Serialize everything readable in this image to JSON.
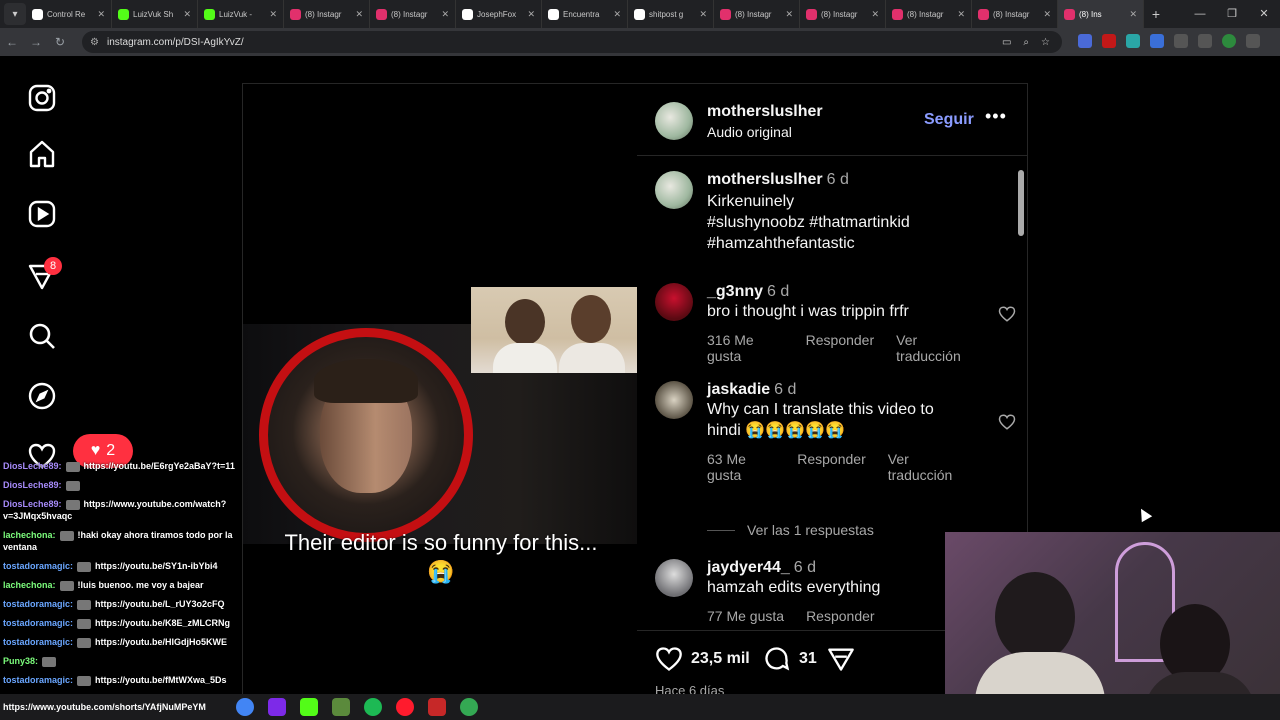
{
  "browser": {
    "tabs": [
      {
        "label": "Control Re",
        "color": "#ffffff"
      },
      {
        "label": "LuizVuk Sh",
        "color": "#53fc18"
      },
      {
        "label": "LuizVuk - ",
        "color": "#53fc18"
      },
      {
        "label": "(8) Instagr",
        "color": "#e1306c"
      },
      {
        "label": "(8) Instagr",
        "color": "#e1306c"
      },
      {
        "label": "JosephFox",
        "color": "#ffffff"
      },
      {
        "label": "Encuentra",
        "color": "#ffffff"
      },
      {
        "label": "shitpost g",
        "color": "#ffffff"
      },
      {
        "label": "(8) Instagr",
        "color": "#e1306c"
      },
      {
        "label": "(8) Instagr",
        "color": "#e1306c"
      },
      {
        "label": "(8) Instagr",
        "color": "#e1306c"
      },
      {
        "label": "(8) Instagr",
        "color": "#e1306c"
      },
      {
        "label": "(8) Ins",
        "color": "#e1306c",
        "active": true
      }
    ],
    "url": "instagram.com/p/DSI-AgIkYvZ/"
  },
  "sidebar": {
    "notification_count": "8",
    "items": [
      "instagram-logo",
      "home",
      "reels",
      "notifications",
      "search",
      "explore",
      "likes"
    ]
  },
  "video": {
    "caption": "Their editor is so funny for this... 😭"
  },
  "post": {
    "author": "mothersluslher",
    "audio": "Audio original",
    "follow_label": "Seguir",
    "more_label": "•••",
    "description": {
      "author": "mothersluslher",
      "time": "6 d",
      "text": "Kirkenuinely",
      "hashtags": "#slushynoobz #thatmartinkid #hamzahthefantastic"
    },
    "comments": [
      {
        "user": "_g3nny",
        "time": "6 d",
        "text": "bro i thought i was trippin frfr",
        "likes": "316 Me gusta",
        "reply": "Responder",
        "translate": "Ver traducción"
      },
      {
        "user": "jaskadie",
        "time": "6 d",
        "text": "Why can I translate this video to hindi 😭😭😭😭😭",
        "likes": "63 Me gusta",
        "reply": "Responder",
        "translate": "Ver traducción"
      },
      {
        "user": "jaydyer44_",
        "time": "6 d",
        "text": "hamzah edits everything",
        "likes": "77 Me gusta",
        "reply": "Responder"
      }
    ],
    "view_replies": "Ver las 1 respuestas",
    "like_count": "23,5 mil",
    "comment_count": "31",
    "date": "Hace 6 días"
  },
  "overlay": {
    "like_pill_count": "2",
    "chat": [
      {
        "user": "DiosLeche89:",
        "color": "#a78bfa",
        "text": "https://youtu.be/E6rgYe2aBaY?t=11"
      },
      {
        "user": "DiosLeche89:",
        "color": "#a78bfa",
        "text": ""
      },
      {
        "user": "DiosLeche89:",
        "color": "#a78bfa",
        "text": "https://www.youtube.com/watch?v=3JMqx5hvaqc"
      },
      {
        "user": "lachechona:",
        "color": "#7cfc7c",
        "text": "!haki okay ahora tiramos todo por la ventana"
      },
      {
        "user": "tostadoramagic:",
        "color": "#6aa6ff",
        "text": "https://youtu.be/SY1n-ibYbi4"
      },
      {
        "user": "lachechona:",
        "color": "#7cfc7c",
        "text": "!luis buenoo. me voy a bajear"
      },
      {
        "user": "tostadoramagic:",
        "color": "#6aa6ff",
        "text": "https://youtu.be/L_rUY3o2cFQ"
      },
      {
        "user": "tostadoramagic:",
        "color": "#6aa6ff",
        "text": "https://youtu.be/K8E_zMLCRNg"
      },
      {
        "user": "tostadoramagic:",
        "color": "#6aa6ff",
        "text": "https://youtu.be/HIGdjHo5KWE"
      },
      {
        "user": "Puny38:",
        "color": "#7cfc7c",
        "text": ""
      },
      {
        "user": "tostadoramagic:",
        "color": "#6aa6ff",
        "text": "https://youtu.be/fMtWXwa_5Ds"
      }
    ],
    "bottom_url": "https://www.youtube.com/shorts/YAfjNuMPeYM"
  }
}
